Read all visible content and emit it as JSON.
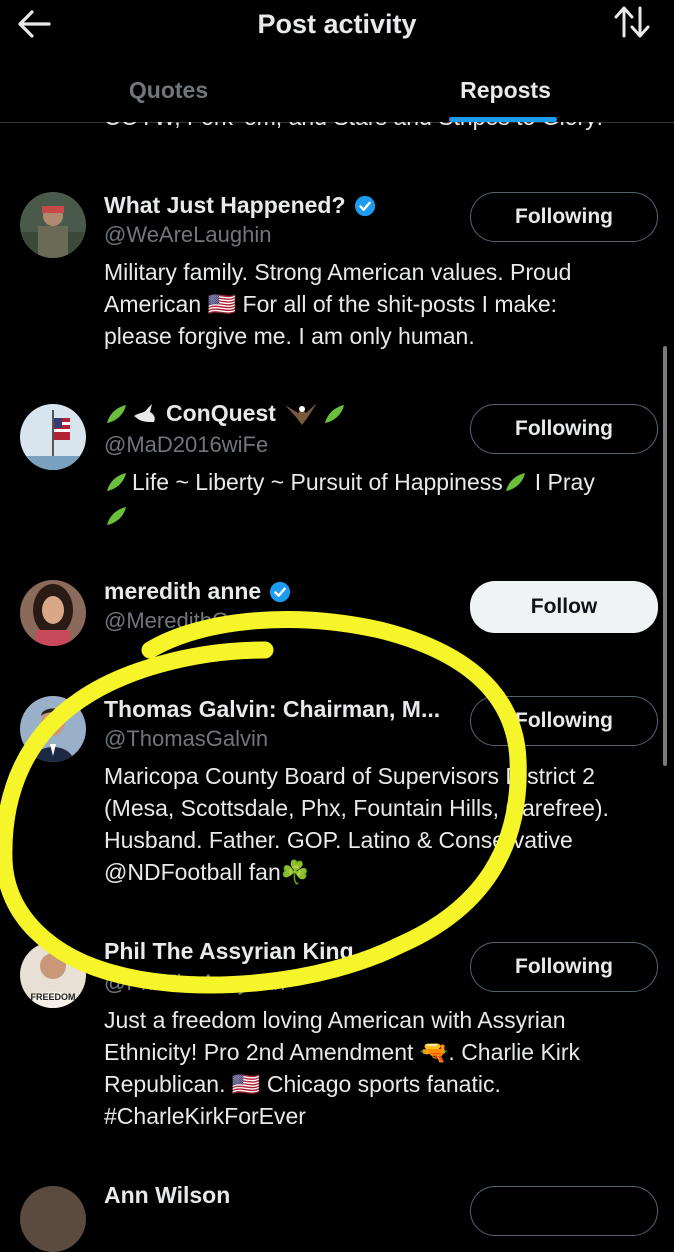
{
  "header": {
    "title": "Post activity",
    "back_icon": "arrow-left-icon",
    "sort_icon": "sort-arrows-icon"
  },
  "tabs": [
    {
      "label": "Quotes",
      "active": false
    },
    {
      "label": "Reposts",
      "active": true
    }
  ],
  "clipped_bio": "COYW, Fork 'em, and Stars and Stripes to Glory!",
  "users": [
    {
      "name": "What Just Happened?",
      "verified": true,
      "handle": "@WeAreLaughin",
      "bio_lines": [
        "Military family. Strong American values. Proud",
        "American 🇺🇸 For all of the shit-posts I make:",
        "please forgive me. I am only human."
      ],
      "button": "Following"
    },
    {
      "name": "ConQuest",
      "verified": false,
      "handle": "@MaD2016wiFe",
      "bio_lines": [
        "Life ~ Liberty ~ Pursuit of Happiness",
        "I Pray"
      ],
      "button": "Following"
    },
    {
      "name": "meredith anne",
      "verified": true,
      "handle": "@MeredithGrum",
      "bio_lines": [],
      "button": "Follow"
    },
    {
      "name": "Thomas Galvin: Chairman, M...",
      "verified": false,
      "handle": "@ThomasGalvin",
      "bio_lines": [
        "Maricopa County Board of Supervisors District 2",
        "(Mesa, Scottsdale, Phx, Fountain Hills, Carefree).",
        "Husband. Father. GOP. Latino & Conservative",
        "@NDFootball fan☘️"
      ],
      "button": "Following"
    },
    {
      "name": "Phil The Assyrian King",
      "verified": false,
      "handle": "@PhilTheAssyrian",
      "bio_lines": [
        "Just a freedom loving American with Assyrian",
        "Ethnicity! Pro 2nd Amendment 🔫. Charlie Kirk",
        "Republican. 🇺🇸 Chicago sports fanatic.",
        "#CharleKirkForEver"
      ],
      "button": "Following"
    },
    {
      "name": "Ann Wilson",
      "verified": false,
      "handle": "",
      "bio_lines": [],
      "button": ""
    }
  ],
  "avatar_text": {
    "phil": "FREEDOM"
  },
  "colors": {
    "background": "#000000",
    "text": "#e7e9ea",
    "muted": "#71767b",
    "accent": "#1d9bf0",
    "highlight": "#f5f52a"
  }
}
